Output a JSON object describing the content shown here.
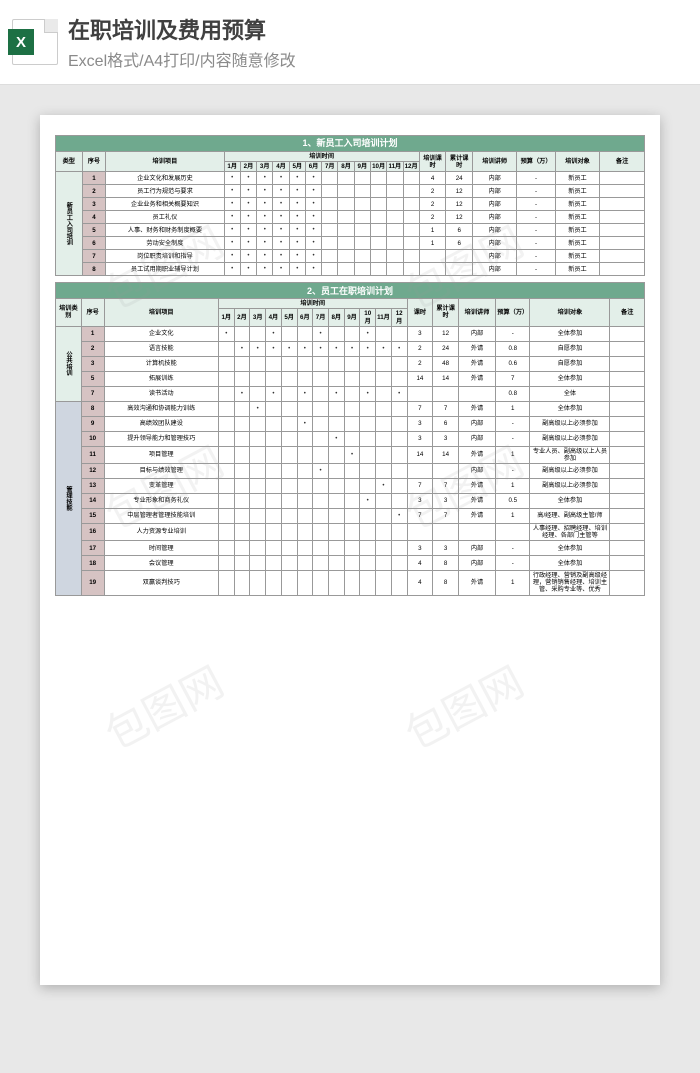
{
  "header": {
    "title": "在职培训及费用预算",
    "subtitle": "Excel格式/A4打印/内容随意修改",
    "icon_letter": "X"
  },
  "watermark": "包图网",
  "table1": {
    "title": "1、新员工入司培训计划",
    "cols": {
      "type": "类型",
      "seq": "序号",
      "project": "培训项目",
      "time": "培训时间",
      "hours": "培训课时",
      "cum": "累计课时",
      "lecturer": "培训讲师",
      "budget": "预算（万）",
      "target": "培训对象",
      "remark": "备注"
    },
    "months": [
      "1月",
      "2月",
      "3月",
      "4月",
      "5月",
      "6月",
      "7月",
      "8月",
      "9月",
      "10月",
      "11月",
      "12月"
    ],
    "type_label": "新员工入司培训",
    "rows": [
      {
        "seq": "1",
        "project": "企业文化和发展历史",
        "dots": [
          1,
          1,
          1,
          1,
          1,
          1,
          0,
          0,
          0,
          0,
          0,
          0
        ],
        "hours": "4",
        "cum": "24",
        "lect": "内部",
        "budget": "-",
        "target": "新员工"
      },
      {
        "seq": "2",
        "project": "员工行为规范与要求",
        "dots": [
          1,
          1,
          1,
          1,
          1,
          1,
          0,
          0,
          0,
          0,
          0,
          0
        ],
        "hours": "2",
        "cum": "12",
        "lect": "内部",
        "budget": "-",
        "target": "新员工"
      },
      {
        "seq": "3",
        "project": "企业业务和相关概要知识",
        "dots": [
          1,
          1,
          1,
          1,
          1,
          1,
          0,
          0,
          0,
          0,
          0,
          0
        ],
        "hours": "2",
        "cum": "12",
        "lect": "内部",
        "budget": "-",
        "target": "新员工"
      },
      {
        "seq": "4",
        "project": "员工礼仪",
        "dots": [
          1,
          1,
          1,
          1,
          1,
          1,
          0,
          0,
          0,
          0,
          0,
          0
        ],
        "hours": "2",
        "cum": "12",
        "lect": "内部",
        "budget": "-",
        "target": "新员工"
      },
      {
        "seq": "5",
        "project": "人事、财务和财务制度概要",
        "dots": [
          1,
          1,
          1,
          1,
          1,
          1,
          0,
          0,
          0,
          0,
          0,
          0
        ],
        "hours": "1",
        "cum": "6",
        "lect": "内部",
        "budget": "-",
        "target": "新员工"
      },
      {
        "seq": "6",
        "project": "劳动安全制度",
        "dots": [
          1,
          1,
          1,
          1,
          1,
          1,
          0,
          0,
          0,
          0,
          0,
          0
        ],
        "hours": "1",
        "cum": "6",
        "lect": "内部",
        "budget": "-",
        "target": "新员工"
      },
      {
        "seq": "7",
        "project": "岗位职责培训和指导",
        "dots": [
          1,
          1,
          1,
          1,
          1,
          1,
          0,
          0,
          0,
          0,
          0,
          0
        ],
        "hours": "",
        "cum": "",
        "lect": "内部",
        "budget": "-",
        "target": "新员工"
      },
      {
        "seq": "8",
        "project": "员工试用期职业辅导计划",
        "dots": [
          1,
          1,
          1,
          1,
          1,
          1,
          0,
          0,
          0,
          0,
          0,
          0
        ],
        "hours": "",
        "cum": "",
        "lect": "内部",
        "budget": "-",
        "target": "新员工"
      }
    ]
  },
  "table2": {
    "title": "2、员工在职培训计划",
    "cols": {
      "type": "培训类别",
      "seq": "序号",
      "project": "培训项目",
      "time": "培训时间",
      "hours": "课时",
      "cum": "累计课时",
      "lect": "培训讲师",
      "budget": "预算（万）",
      "target": "培训对象",
      "remark": "备注"
    },
    "months": [
      "1月",
      "2月",
      "3月",
      "4月",
      "5月",
      "6月",
      "7月",
      "8月",
      "9月",
      "10月",
      "11月",
      "12月"
    ],
    "group1": "公共培训",
    "group2": "管理技能",
    "rows1": [
      {
        "seq": "1",
        "project": "企业文化",
        "dots": [
          1,
          0,
          0,
          1,
          0,
          0,
          1,
          0,
          0,
          1,
          0,
          0
        ],
        "hours": "3",
        "cum": "12",
        "lect": "内部",
        "budget": "-",
        "target": "全体参加"
      },
      {
        "seq": "2",
        "project": "语言技能",
        "dots": [
          0,
          1,
          1,
          1,
          1,
          1,
          1,
          1,
          1,
          1,
          1,
          1
        ],
        "hours": "2",
        "cum": "24",
        "lect": "外请",
        "budget": "0.8",
        "target": "自愿参加"
      },
      {
        "seq": "3",
        "project": "计算机技能",
        "dots": [
          0,
          0,
          0,
          0,
          0,
          0,
          0,
          0,
          0,
          0,
          0,
          0
        ],
        "hours": "2",
        "cum": "48",
        "lect": "外请",
        "budget": "0.6",
        "target": "自愿参加"
      },
      {
        "seq": "5",
        "project": "拓展训练",
        "dots": [
          0,
          0,
          0,
          0,
          0,
          0,
          0,
          0,
          0,
          0,
          0,
          0
        ],
        "hours": "14",
        "cum": "14",
        "lect": "外请",
        "budget": "7",
        "target": "全体参加"
      },
      {
        "seq": "7",
        "project": "读书活动",
        "dots": [
          0,
          1,
          0,
          1,
          0,
          1,
          0,
          1,
          0,
          1,
          0,
          1
        ],
        "hours": "",
        "cum": "",
        "lect": "",
        "budget": "0.8",
        "target": "全体"
      }
    ],
    "rows2": [
      {
        "seq": "8",
        "project": "高效沟通和协调能力训练",
        "dots": [
          0,
          0,
          1,
          0,
          0,
          0,
          0,
          0,
          0,
          0,
          0,
          0
        ],
        "hours": "7",
        "cum": "7",
        "lect": "外请",
        "budget": "1",
        "target": "全体参加"
      },
      {
        "seq": "9",
        "project": "高绩效团队建设",
        "dots": [
          0,
          0,
          0,
          0,
          0,
          1,
          0,
          0,
          0,
          0,
          0,
          0
        ],
        "hours": "3",
        "cum": "6",
        "lect": "内部",
        "budget": "-",
        "target": "副高级以上必须参加"
      },
      {
        "seq": "10",
        "project": "提升领导能力和管理技巧",
        "dots": [
          0,
          0,
          0,
          0,
          0,
          0,
          0,
          1,
          0,
          0,
          0,
          0
        ],
        "hours": "3",
        "cum": "3",
        "lect": "内部",
        "budget": "-",
        "target": "副高级以上必须参加"
      },
      {
        "seq": "11",
        "project": "项目管理",
        "dots": [
          0,
          0,
          0,
          0,
          0,
          0,
          0,
          0,
          1,
          0,
          0,
          0
        ],
        "hours": "14",
        "cum": "14",
        "lect": "外请",
        "budget": "1",
        "target": "专业人员、副高级以上人员参加"
      },
      {
        "seq": "12",
        "project": "目标与绩效管理",
        "dots": [
          0,
          0,
          0,
          0,
          0,
          0,
          1,
          0,
          0,
          0,
          0,
          0
        ],
        "hours": "",
        "cum": "",
        "lect": "内部",
        "budget": "-",
        "target": "副高级以上必须参加"
      },
      {
        "seq": "13",
        "project": "变革管理",
        "dots": [
          0,
          0,
          0,
          0,
          0,
          0,
          0,
          0,
          0,
          0,
          1,
          0
        ],
        "hours": "7",
        "cum": "7",
        "lect": "外请",
        "budget": "1",
        "target": "副高级以上必须参加"
      },
      {
        "seq": "14",
        "project": "专业形象和商务礼仪",
        "dots": [
          0,
          0,
          0,
          0,
          0,
          0,
          0,
          0,
          0,
          1,
          0,
          0
        ],
        "hours": "3",
        "cum": "3",
        "lect": "外请",
        "budget": "0.5",
        "target": "全体参加"
      },
      {
        "seq": "15",
        "project": "中层管理者管理技能培训",
        "dots": [
          0,
          0,
          0,
          0,
          0,
          0,
          0,
          0,
          0,
          0,
          0,
          1
        ],
        "hours": "7",
        "cum": "7",
        "lect": "外请",
        "budget": "1",
        "target": "高/经理、副高级主管/师"
      },
      {
        "seq": "16",
        "project": "人力资源专业培训",
        "dots": [
          0,
          0,
          0,
          0,
          0,
          0,
          0,
          0,
          0,
          0,
          0,
          0
        ],
        "hours": "",
        "cum": "",
        "lect": "",
        "budget": "",
        "target": "人事经理、招聘经理、培训经理、各部门主管等"
      },
      {
        "seq": "17",
        "project": "时间管理",
        "dots": [
          0,
          0,
          0,
          0,
          0,
          0,
          0,
          0,
          0,
          0,
          0,
          0
        ],
        "hours": "3",
        "cum": "3",
        "lect": "内部",
        "budget": "-",
        "target": "全体参加"
      },
      {
        "seq": "18",
        "project": "会议管理",
        "dots": [
          0,
          0,
          0,
          0,
          0,
          0,
          0,
          0,
          0,
          0,
          0,
          0
        ],
        "hours": "4",
        "cum": "8",
        "lect": "内部",
        "budget": "-",
        "target": "全体参加"
      },
      {
        "seq": "19",
        "project": "双赢谈判技巧",
        "dots": [
          0,
          0,
          0,
          0,
          0,
          0,
          0,
          0,
          0,
          0,
          0,
          0
        ],
        "hours": "4",
        "cum": "8",
        "lect": "外请",
        "budget": "1",
        "target": "行政经理、营销及副高级经理，营销销售经理、培训主管、采购专业等、优秀"
      }
    ]
  }
}
